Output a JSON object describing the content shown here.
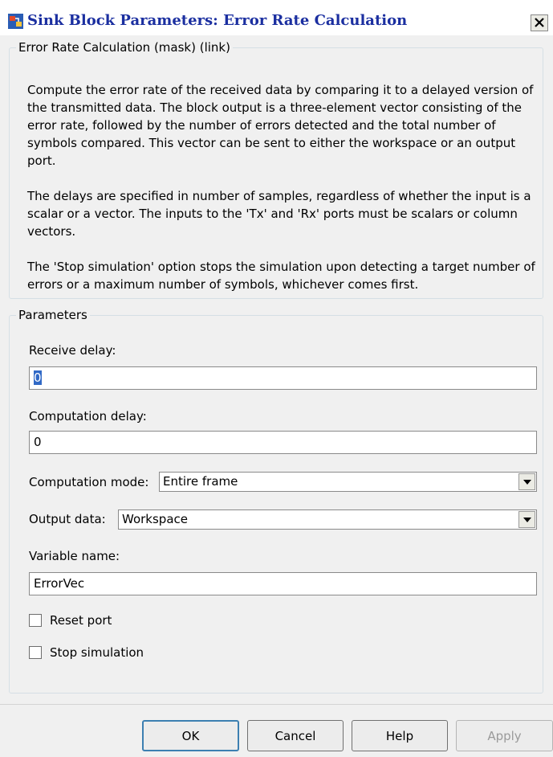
{
  "window": {
    "title": "Sink Block Parameters: Error Rate Calculation",
    "title_color": "#1b2fa0",
    "close_label": "×"
  },
  "description": {
    "legend": "Error Rate Calculation (mask) (link)",
    "paragraphs": [
      "Compute the error rate of the received data by comparing it to a delayed version of the transmitted data. The block output is a three-element vector consisting of the error rate, followed by the number of errors detected and the total number of symbols compared. This vector can be sent to either the workspace or an output port.",
      "The delays are specified in number of samples, regardless of whether the input is a scalar or a vector. The inputs to the 'Tx' and 'Rx' ports must be scalars or column vectors.",
      "The 'Stop simulation' option stops the simulation upon detecting a target number of errors or a maximum number of symbols, whichever comes first."
    ]
  },
  "parameters": {
    "legend": "Parameters",
    "receive_delay": {
      "label": "Receive delay:",
      "value": "0",
      "selected": true
    },
    "computation_delay": {
      "label": "Computation delay:",
      "value": "0"
    },
    "computation_mode": {
      "label": "Computation mode:",
      "value": "Entire frame"
    },
    "output_data": {
      "label": "Output data:",
      "value": "Workspace"
    },
    "variable_name": {
      "label": "Variable name:",
      "value": "ErrorVec"
    },
    "reset_port": {
      "label": "Reset port",
      "checked": false
    },
    "stop_simulation": {
      "label": "Stop simulation",
      "checked": false
    }
  },
  "buttons": {
    "ok": "OK",
    "cancel": "Cancel",
    "help": "Help",
    "apply": "Apply",
    "apply_enabled": false
  },
  "icons": {
    "title_icon": "simulink-block-icon",
    "dropdown_icon": "chevron-down-icon",
    "close_icon": "close-icon"
  },
  "colors": {
    "accent": "#3c7fb1",
    "selection": "#3169c6"
  }
}
